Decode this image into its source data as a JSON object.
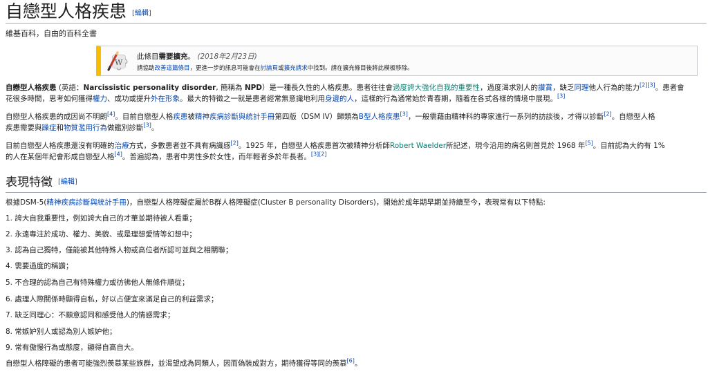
{
  "title": "自戀型人格疾患",
  "edit_label": "編輯",
  "edit_open": "[",
  "edit_close": "]",
  "tagline": "維基百科，自由的百科全書",
  "ambox": {
    "line1_a": "此條目",
    "line1_b": "需要擴充",
    "line1_c": "。",
    "line1_date": "(2018年2月23日)",
    "line2_a": "請協助",
    "line2_link1": "改善這篇條目",
    "line2_b": "，更進一步的訊息可能會在",
    "line2_link2": "討論頁",
    "line2_c": "或",
    "line2_link3": "擴充請求",
    "line2_d": "中找到。請在擴充條目後將此模板移除。"
  },
  "intro": {
    "p1l1_bold1": "自戀型人格疾患",
    "p1l1_a": " (英語：",
    "p1l1_bold2": "Narcissistic personality disorder",
    "p1l1_b": ", 簡稱為 ",
    "p1l1_bold3": "NPD",
    "p1l1_c": "）是一種長久性的人格疾患。患者往往會",
    "p1l1_link1": "過度誇大強化自我的重要性",
    "p1l1_d": "，過度渴求別人的",
    "p1l1_link2": "讚賞",
    "p1l1_e": "，缺乏",
    "p1l1_link3": "同理",
    "p1l1_f": "他人行為的能力",
    "p1l1_sup": "[2][3]",
    "p1l1_g": "。患者會",
    "p1l2_a": "花很多時間，思考如何獲得",
    "p1l2_link1": "權力",
    "p1l2_b": "、成功或提升",
    "p1l2_link2": "外在形象",
    "p1l2_c": "。最大的特徵之一就是患者經常無意識地利用",
    "p1l2_link3": "身邊的人",
    "p1l2_d": "，這樣的行為通常始於青春期，隨着在各式各樣的情境中展現。",
    "p1l2_sup": "[3]",
    "p2l1_a": "自戀型人格疾患的成因尚不明朗",
    "p2l1_sup1": "[4]",
    "p2l1_b": "。目前自戀型人格",
    "p2l1_link1": "疾患",
    "p2l1_c": "被",
    "p2l1_link2": "精神疾病診斷與統計手冊",
    "p2l1_d": "第四版（DSM IV）歸類為",
    "p2l1_link3": "B型人格疾患",
    "p2l1_sup2": "[3]",
    "p2l1_e": "，一般需藉由精神科的專家進行一系列的訪談後，才得以診斷",
    "p2l1_sup3": "[2]",
    "p2l1_f": "。自戀型人格",
    "p2l2_a": "疾患需要與",
    "p2l2_link1": "躁症",
    "p2l2_b": "和",
    "p2l2_link2": "物質濫用行為",
    "p2l2_c": "做鑑別診斷",
    "p2l2_sup": "[3]",
    "p2l2_d": "。",
    "p3l1_a": "目前自戀型人格疾患還沒有明確的",
    "p3l1_link1": "治療",
    "p3l1_b": "方式，多數患者並不具有病識感",
    "p3l1_sup1": "[2]",
    "p3l1_c": "。1925 年，自戀型人格疾患首次被精神分析師",
    "p3l1_link2": "Robert Waelder",
    "p3l1_d": "所記述，現今沿用的病名則首見於 1968 年",
    "p3l1_sup2": "[5]",
    "p3l1_e": "。目前認為大約有 1%",
    "p3l2_a": "的人在某個年紀會形成自戀型人格",
    "p3l2_sup1": "[4]",
    "p3l2_b": "。普遍認為，患者中男性多於女性，而年輕者多於年長者。",
    "p3l2_sup2": "[3][2]"
  },
  "section": {
    "heading": "表現特徵",
    "lead_a": "根據DSM-5(",
    "lead_link": "精神疾病診斷與統計手冊",
    "lead_b": ")，自戀型人格障礙症屬於B群人格障礙症(Cluster B personality Disorders)，開始於成年期早期並持續至今，表現常有以下特點:",
    "items": [
      "1. 誇大自我重要性，例如誇大自己的才華並期待被人看重；",
      "2. 永遠專注於成功、權力、美貌、或是理想愛情等幻想中；",
      "3. 認為自己獨特，僅能被其他特殊人物或高位者所認可並與之相關聯；",
      "4. 需要過度的稱讚；",
      "5. 不合理的認為自己有特殊權力或彷彿他人無條件順從；",
      "6. 處理人際關係時顯得自私，好以占便宜來滿足自己的利益需求；",
      "7. 缺乏同理心：不願意認同和感受他人的情感需求；",
      "8. 常嫉妒別人或認為別人嫉妒他；",
      "9. 常有傲慢行為或態度，顯得自高自大。"
    ],
    "closing_a": "自戀型人格障礙的患者可能強烈羨慕某些族群，並渴望成為同類人，因而偽裝成對方，期待獲得等同的羨慕",
    "closing_sup": "[6]",
    "closing_b": "。"
  },
  "colors": {
    "link": "#0645ad",
    "ambox_stripe": "#f7bd00",
    "rule": "#a2a9b1"
  }
}
